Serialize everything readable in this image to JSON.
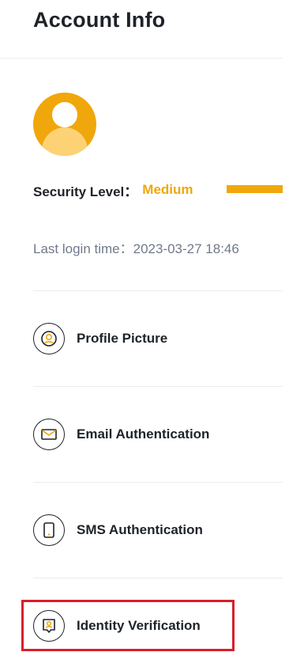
{
  "header": {
    "title": "Account Info"
  },
  "account": {
    "security_label": "Security Level：",
    "security_value": "Medium",
    "last_login": "Last login time：2023-03-27 18:46"
  },
  "items": [
    {
      "label": "Profile Picture",
      "icon": "profile-picture-icon"
    },
    {
      "label": "Email Authentication",
      "icon": "email-icon"
    },
    {
      "label": "SMS Authentication",
      "icon": "phone-icon"
    },
    {
      "label": "Identity Verification",
      "icon": "identity-verification-icon"
    }
  ],
  "colors": {
    "accent": "#f0a70b",
    "text": "#1e2329",
    "muted": "#707a8a",
    "highlight": "#d81e2b"
  }
}
